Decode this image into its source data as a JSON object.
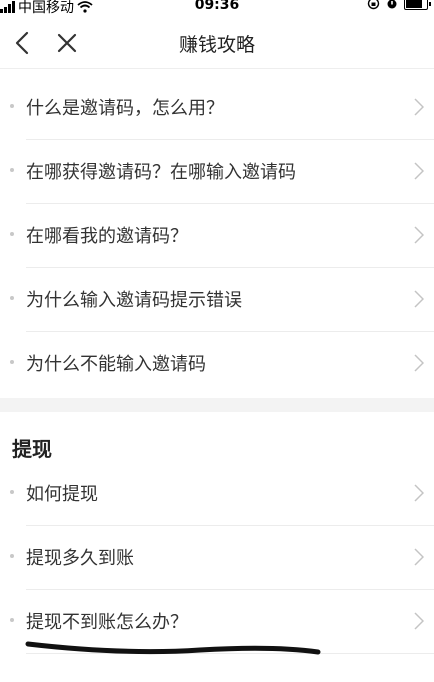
{
  "status_bar": {
    "carrier": "中国移动",
    "time": "09:36"
  },
  "nav": {
    "title": "赚钱攻略"
  },
  "faq_group_invite": {
    "items": [
      {
        "label": "什么是邀请码，怎么用？"
      },
      {
        "label": "在哪获得邀请码？在哪输入邀请码"
      },
      {
        "label": "在哪看我的邀请码？"
      },
      {
        "label": "为什么输入邀请码提示错误"
      },
      {
        "label": "为什么不能输入邀请码"
      }
    ]
  },
  "faq_group_withdraw": {
    "title": "提现",
    "items": [
      {
        "label": "如何提现"
      },
      {
        "label": "提现多久到账"
      },
      {
        "label": "提现不到账怎么办？"
      }
    ]
  }
}
